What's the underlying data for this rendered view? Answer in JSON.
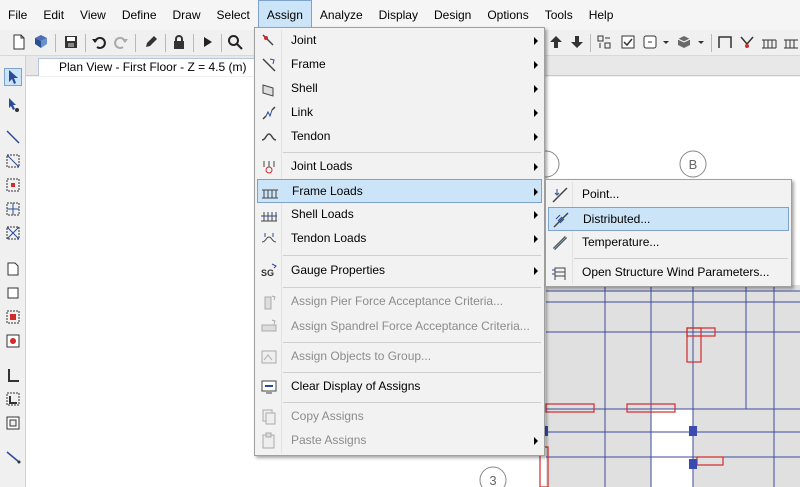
{
  "menubar": {
    "items": [
      {
        "label": "File"
      },
      {
        "label": "Edit"
      },
      {
        "label": "View"
      },
      {
        "label": "Define"
      },
      {
        "label": "Draw"
      },
      {
        "label": "Select"
      },
      {
        "label": "Assign"
      },
      {
        "label": "Analyze"
      },
      {
        "label": "Display"
      },
      {
        "label": "Design"
      },
      {
        "label": "Options"
      },
      {
        "label": "Tools"
      },
      {
        "label": "Help"
      }
    ],
    "active": "Assign"
  },
  "view_tab": {
    "title": "Plan View - First Floor - Z = 4.5 (m)"
  },
  "grid_bubbles": {
    "b": "B",
    "three": "3"
  },
  "assign_menu": {
    "items": [
      {
        "label": "Joint",
        "icon": "joint-icon",
        "submenu": true,
        "enabled": true
      },
      {
        "label": "Frame",
        "icon": "frame-icon",
        "submenu": true,
        "enabled": true
      },
      {
        "label": "Shell",
        "icon": "shell-icon",
        "submenu": true,
        "enabled": true
      },
      {
        "label": "Link",
        "icon": "link-icon",
        "submenu": true,
        "enabled": true
      },
      {
        "label": "Tendon",
        "icon": "tendon-icon",
        "submenu": true,
        "enabled": true
      },
      {
        "label": "Joint Loads",
        "icon": "joint-loads-icon",
        "submenu": true,
        "enabled": true
      },
      {
        "label": "Frame Loads",
        "icon": "frame-loads-icon",
        "submenu": true,
        "enabled": true,
        "highlighted": true
      },
      {
        "label": "Shell Loads",
        "icon": "shell-loads-icon",
        "submenu": true,
        "enabled": true
      },
      {
        "label": "Tendon Loads",
        "icon": "tendon-loads-icon",
        "submenu": true,
        "enabled": true
      },
      {
        "label": "Gauge Properties",
        "icon": "gauge-properties-icon",
        "submenu": true,
        "enabled": true
      },
      {
        "label": "Assign Pier Force Acceptance Criteria...",
        "icon": "pier-criteria-icon",
        "submenu": false,
        "enabled": false
      },
      {
        "label": "Assign Spandrel Force Acceptance Criteria...",
        "icon": "spandrel-criteria-icon",
        "submenu": false,
        "enabled": false
      },
      {
        "label": "Assign Objects to Group...",
        "icon": "group-icon",
        "submenu": false,
        "enabled": false
      },
      {
        "label": "Clear Display of Assigns",
        "icon": "clear-display-icon",
        "submenu": false,
        "enabled": true
      },
      {
        "label": "Copy Assigns",
        "icon": "copy-assigns-icon",
        "submenu": false,
        "enabled": false
      },
      {
        "label": "Paste Assigns",
        "icon": "paste-assigns-icon",
        "submenu": true,
        "enabled": false
      }
    ]
  },
  "frame_loads_menu": {
    "items": [
      {
        "label": "Point...",
        "icon": "point-load-icon"
      },
      {
        "label": "Distributed...",
        "icon": "distributed-load-icon",
        "highlighted": true
      },
      {
        "label": "Temperature...",
        "icon": "temperature-load-icon"
      },
      {
        "label": "Open Structure Wind Parameters...",
        "icon": "wind-parameters-icon"
      }
    ]
  },
  "colors": {
    "menu_highlight": "#cce4f7",
    "menu_highlight_border": "#7da2ce",
    "grid_line": "#3c4a9c",
    "beam_red": "#d42a2a",
    "slab_gray": "#e0e0e0",
    "joint_blue": "#3a4ab0"
  }
}
